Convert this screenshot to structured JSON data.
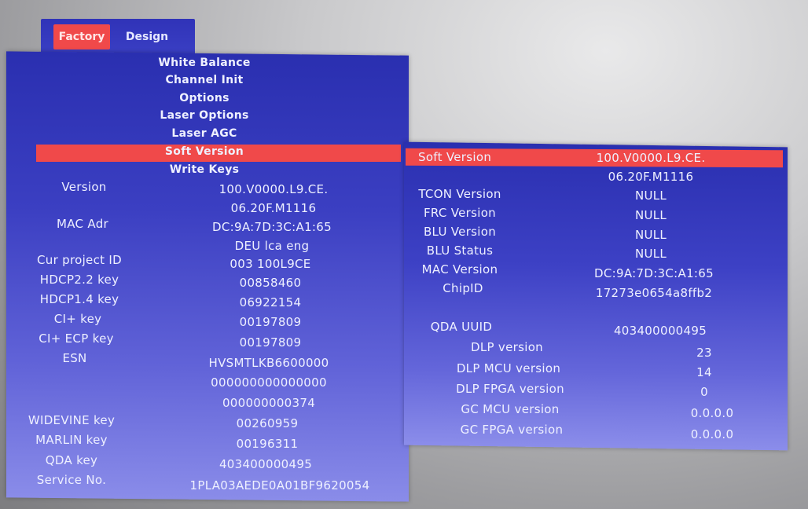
{
  "tabs": [
    {
      "label": "Factory",
      "active": true
    },
    {
      "label": "Design",
      "active": false
    }
  ],
  "menu": [
    "White Balance",
    "Channel Init",
    "Options",
    "Laser Options",
    "Laser AGC",
    "Soft Version",
    "Write Keys"
  ],
  "left_info": {
    "version_label": "Version",
    "version_value_1": "100.V0000.L9.CE.",
    "version_value_2": "06.20F.M1116",
    "mac_label": "MAC Adr",
    "mac_value": "DC:9A:7D:3C:A1:65",
    "region_value": "DEU lca eng",
    "project_label": "Cur project ID",
    "project_value": "003 100L9CE",
    "hdcp22_label": "HDCP2.2 key",
    "hdcp22_value": "00858460",
    "hdcp14_label": "HDCP1.4 key",
    "hdcp14_value": "06922154",
    "ciplus_label": "CI+ key",
    "ciplus_value": "00197809",
    "ciplus_ecp_label": "CI+ ECP key",
    "ciplus_ecp_value": "00197809",
    "esn_label": "ESN",
    "esn_value_1": "HVSMTLKB6600000",
    "esn_value_2": "000000000000000",
    "esn_value_3": "000000000374",
    "widevine_label": "WIDEVINE key",
    "widevine_value": "00260959",
    "marlin_label": "MARLIN key",
    "marlin_value": "00196311",
    "qda_label": "QDA key",
    "qda_value": "403400000495",
    "service_label": "Service No.",
    "service_value": "1PLA03AEDE0A01BF9620054"
  },
  "right_info": {
    "soft_label": "Soft Version",
    "soft_value_1": "100.V0000.L9.CE.",
    "soft_value_2": "06.20F.M1116",
    "tcon_label": "TCON Version",
    "tcon_value": "NULL",
    "frc_label": "FRC Version",
    "frc_value": "NULL",
    "blu_label": "BLU Version",
    "blu_value": "NULL",
    "blu_status_label": "BLU Status",
    "blu_status_value": "NULL",
    "mac_label": "MAC Version",
    "mac_value": "DC:9A:7D:3C:A1:65",
    "chip_label": "ChipID",
    "chip_value": "17273e0654a8ffb2",
    "qda_uuid_label": "QDA UUID",
    "qda_uuid_value": "403400000495",
    "dlp_label": "DLP version",
    "dlp_value": "23",
    "dlp_mcu_label": "DLP MCU version",
    "dlp_mcu_value": "14",
    "dlp_fpga_label": "DLP FPGA version",
    "dlp_fpga_value": "0",
    "gc_mcu_label": "GC MCU version",
    "gc_mcu_value": "0.0.0.0",
    "gc_fpga_label": "GC FPGA version",
    "gc_fpga_value": "0.0.0.0"
  },
  "colors": {
    "panel": "#3033b8",
    "highlight": "#f0494a",
    "text": "#eef0ff"
  }
}
